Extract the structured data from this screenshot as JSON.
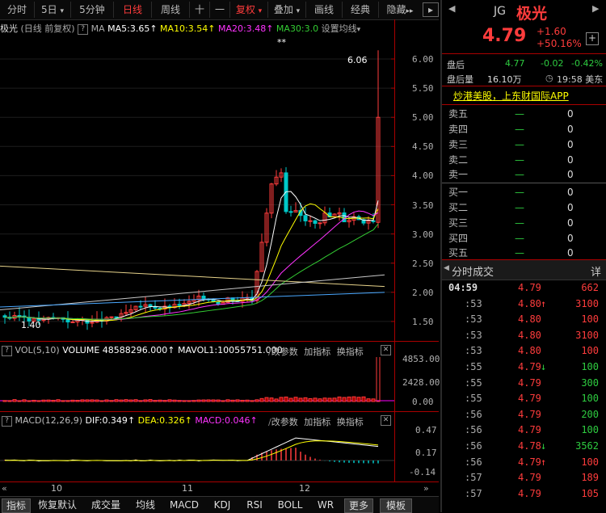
{
  "toolbar": {
    "items": [
      "分时",
      "5日",
      "5分钟",
      "日线",
      "周线",
      "十",
      "一",
      "复权",
      "叠加",
      "画线",
      "经典",
      "隐藏"
    ],
    "active": "日线"
  },
  "chart_head": {
    "name": "极光",
    "mode": "(日线 前复权)",
    "help": "?",
    "ma_prefix": "MA",
    "ma5": "MA5:3.65",
    "ma10": "MA10:3.54",
    "ma20": "MA20:3.48",
    "ma30": "MA30:3.0",
    "settings": "设置均线"
  },
  "price_axis": [
    "6.00",
    "5.50",
    "5.00",
    "4.50",
    "4.00",
    "3.50",
    "3.00",
    "2.50",
    "2.00",
    "1.50"
  ],
  "annotations": {
    "high": "6.06",
    "low": "1.40",
    "marker": "**"
  },
  "vol_head": {
    "help": "?",
    "name": "VOL(5,10)",
    "volume": "VOLUME 48588296.000",
    "mavol": "MAVOL1:10055751.000",
    "change": "改参数",
    "add": "加指标",
    "swap": "换指标"
  },
  "vol_axis": [
    "4853.00",
    "2428.00",
    "0.00"
  ],
  "macd_head": {
    "help": "?",
    "name": "MACD(12,26,9)",
    "dif": "DIF:0.349",
    "dea": "DEA:0.326",
    "macd": "MACD:0.046",
    "change": "改参数",
    "add": "加指标",
    "swap": "换指标"
  },
  "macd_axis": [
    "0.47",
    "0.17",
    "-0.14"
  ],
  "date_axis": [
    "10",
    "11",
    "12"
  ],
  "bottom_tabs": [
    "指标",
    "恢复默认",
    "成交量",
    "均线",
    "MACD",
    "KDJ",
    "RSI",
    "BOLL",
    "WR",
    "更多",
    "模板"
  ],
  "quote": {
    "exchange": "JG",
    "name": "极光",
    "price": "4.79",
    "change": "+1.60",
    "change_pct": "+50.16%",
    "add_btn": "+",
    "after_label": "盘后",
    "after_price": "4.77",
    "after_change": "-0.02",
    "after_pct": "-0.42%",
    "after_vol_label": "盘后量",
    "after_vol": "16.10万",
    "time": "19:58 美东",
    "promo": "炒港美股，上东财国际APP"
  },
  "orderbook": [
    {
      "label": "卖五",
      "price": "—",
      "qty": "0"
    },
    {
      "label": "卖四",
      "price": "—",
      "qty": "0"
    },
    {
      "label": "卖三",
      "price": "—",
      "qty": "0"
    },
    {
      "label": "卖二",
      "price": "—",
      "qty": "0"
    },
    {
      "label": "卖一",
      "price": "—",
      "qty": "0"
    },
    {
      "label": "买一",
      "price": "—",
      "qty": "0"
    },
    {
      "label": "买二",
      "price": "—",
      "qty": "0"
    },
    {
      "label": "买三",
      "price": "—",
      "qty": "0"
    },
    {
      "label": "买四",
      "price": "—",
      "qty": "0"
    },
    {
      "label": "买五",
      "price": "—",
      "qty": "0"
    }
  ],
  "trades_header": {
    "title": "分时成交",
    "detail": "详"
  },
  "trades": [
    {
      "time": "04:59",
      "price": "4.79",
      "arrow": "",
      "vol": "662",
      "vol_color": "#ff3c3c"
    },
    {
      "time": ":53",
      "price": "4.80",
      "arrow": "↑",
      "vol": "3100",
      "vol_color": "#ff3c3c"
    },
    {
      "time": ":53",
      "price": "4.80",
      "arrow": "",
      "vol": "100",
      "vol_color": "#ff3c3c"
    },
    {
      "time": ":53",
      "price": "4.80",
      "arrow": "",
      "vol": "3100",
      "vol_color": "#ff3c3c"
    },
    {
      "time": ":53",
      "price": "4.80",
      "arrow": "",
      "vol": "100",
      "vol_color": "#ff3c3c"
    },
    {
      "time": ":55",
      "price": "4.79",
      "arrow": "↓",
      "vol": "100",
      "vol_color": "#2ecc40"
    },
    {
      "time": ":55",
      "price": "4.79",
      "arrow": "",
      "vol": "300",
      "vol_color": "#2ecc40"
    },
    {
      "time": ":55",
      "price": "4.79",
      "arrow": "",
      "vol": "100",
      "vol_color": "#2ecc40"
    },
    {
      "time": ":56",
      "price": "4.79",
      "arrow": "",
      "vol": "200",
      "vol_color": "#2ecc40"
    },
    {
      "time": ":56",
      "price": "4.79",
      "arrow": "",
      "vol": "100",
      "vol_color": "#2ecc40"
    },
    {
      "time": ":56",
      "price": "4.78",
      "arrow": "↓",
      "vol": "3562",
      "vol_color": "#2ecc40"
    },
    {
      "time": ":56",
      "price": "4.79",
      "arrow": "↑",
      "vol": "100",
      "vol_color": "#ff3c3c"
    },
    {
      "time": ":57",
      "price": "4.79",
      "arrow": "",
      "vol": "189",
      "vol_color": "#ff3c3c"
    },
    {
      "time": ":57",
      "price": "4.79",
      "arrow": "",
      "vol": "105",
      "vol_color": "#ff3c3c"
    }
  ],
  "colors": {
    "up": "#ff3c3c",
    "down": "#2ecc40",
    "ma5": "#ffffff",
    "ma10": "#ffff00",
    "ma20": "#ff33ff",
    "ma30": "#33cc33",
    "border": "#aa0000"
  }
}
